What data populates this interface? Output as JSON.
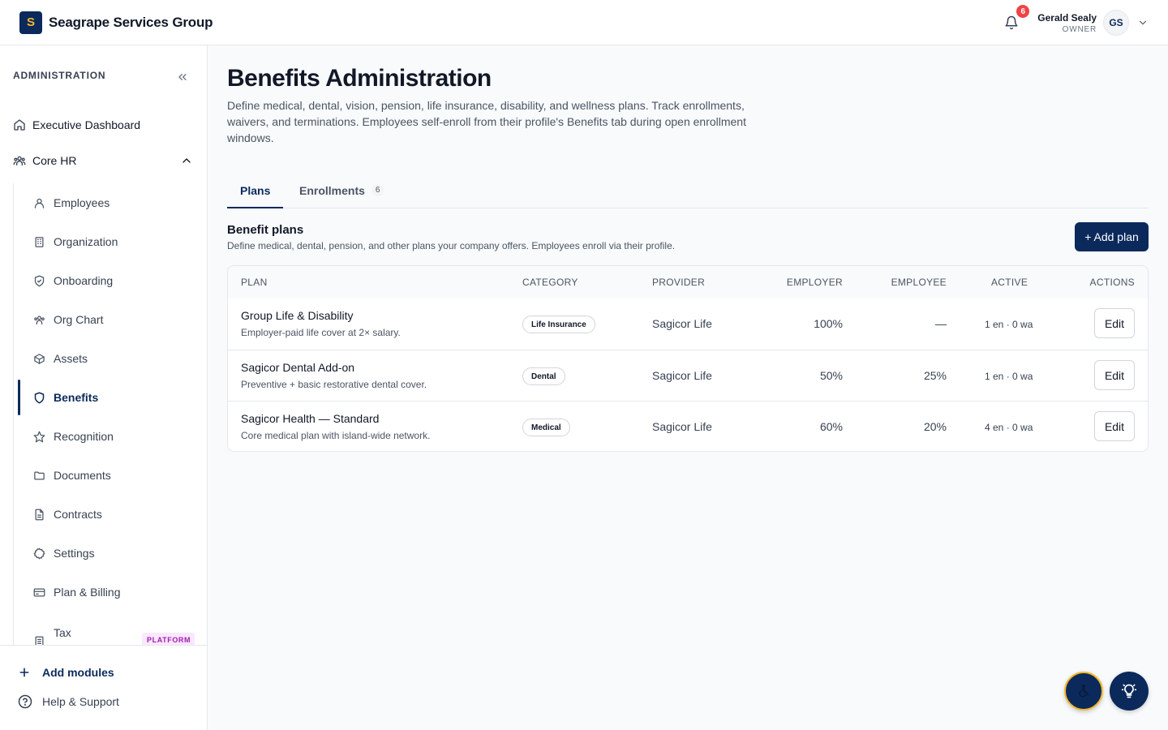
{
  "header": {
    "logo_letter": "S",
    "company_name": "Seagrape Services Group",
    "notification_count": "6",
    "user_name": "Gerald Sealy",
    "user_role": "OWNER",
    "user_initials": "GS"
  },
  "sidebar": {
    "section_title": "ADMINISTRATION",
    "executive_dashboard": "Executive Dashboard",
    "core_hr": "Core HR",
    "items": [
      {
        "label": "Employees",
        "icon": "user-icon"
      },
      {
        "label": "Organization",
        "icon": "building-icon"
      },
      {
        "label": "Onboarding",
        "icon": "shield-check-icon"
      },
      {
        "label": "Org Chart",
        "icon": "users-icon"
      },
      {
        "label": "Assets",
        "icon": "box-icon"
      },
      {
        "label": "Benefits",
        "icon": "shield-icon",
        "active": true
      },
      {
        "label": "Recognition",
        "icon": "star-icon"
      },
      {
        "label": "Documents",
        "icon": "folder-icon"
      },
      {
        "label": "Contracts",
        "icon": "file-icon"
      },
      {
        "label": "Settings",
        "icon": "gear-icon"
      },
      {
        "label": "Plan & Billing",
        "icon": "card-icon"
      },
      {
        "label": "Tax Reports",
        "icon": "document-icon",
        "badge": "PLATFORM"
      }
    ],
    "add_modules": "Add modules",
    "help_support": "Help & Support"
  },
  "page": {
    "title": "Benefits Administration",
    "description": "Define medical, dental, vision, pension, life insurance, disability, and wellness plans. Track enrollments, waivers, and terminations. Employees self-enroll from their profile's Benefits tab during open enrollment windows."
  },
  "tabs": [
    {
      "label": "Plans",
      "active": true
    },
    {
      "label": "Enrollments",
      "count": "6"
    }
  ],
  "section": {
    "title": "Benefit plans",
    "description": "Define medical, dental, pension, and other plans your company offers. Employees enroll via their profile.",
    "add_button": "+ Add plan"
  },
  "table": {
    "headers": {
      "plan": "PLAN",
      "category": "CATEGORY",
      "provider": "PROVIDER",
      "employer": "EMPLOYER",
      "employee": "EMPLOYEE",
      "active": "ACTIVE",
      "actions": "ACTIONS"
    },
    "rows": [
      {
        "name": "Group Life & Disability",
        "description": "Employer-paid life cover at 2× salary.",
        "category": "Life Insurance",
        "provider": "Sagicor Life",
        "employer": "100%",
        "employee": "—",
        "active": "1 en · 0 wa",
        "action": "Edit"
      },
      {
        "name": "Sagicor Dental Add-on",
        "description": "Preventive + basic restorative dental cover.",
        "category": "Dental",
        "provider": "Sagicor Life",
        "employer": "50%",
        "employee": "25%",
        "active": "1 en · 0 wa",
        "action": "Edit"
      },
      {
        "name": "Sagicor Health — Standard",
        "description": "Core medical plan with island-wide network.",
        "category": "Medical",
        "provider": "Sagicor Life",
        "employer": "60%",
        "employee": "20%",
        "active": "4 en · 0 wa",
        "action": "Edit"
      }
    ]
  },
  "colors": {
    "brand_navy": "#0b2a5b",
    "brand_gold": "#f5b82e",
    "badge_red": "#ef4444",
    "platform_purple": "#a21caf"
  }
}
